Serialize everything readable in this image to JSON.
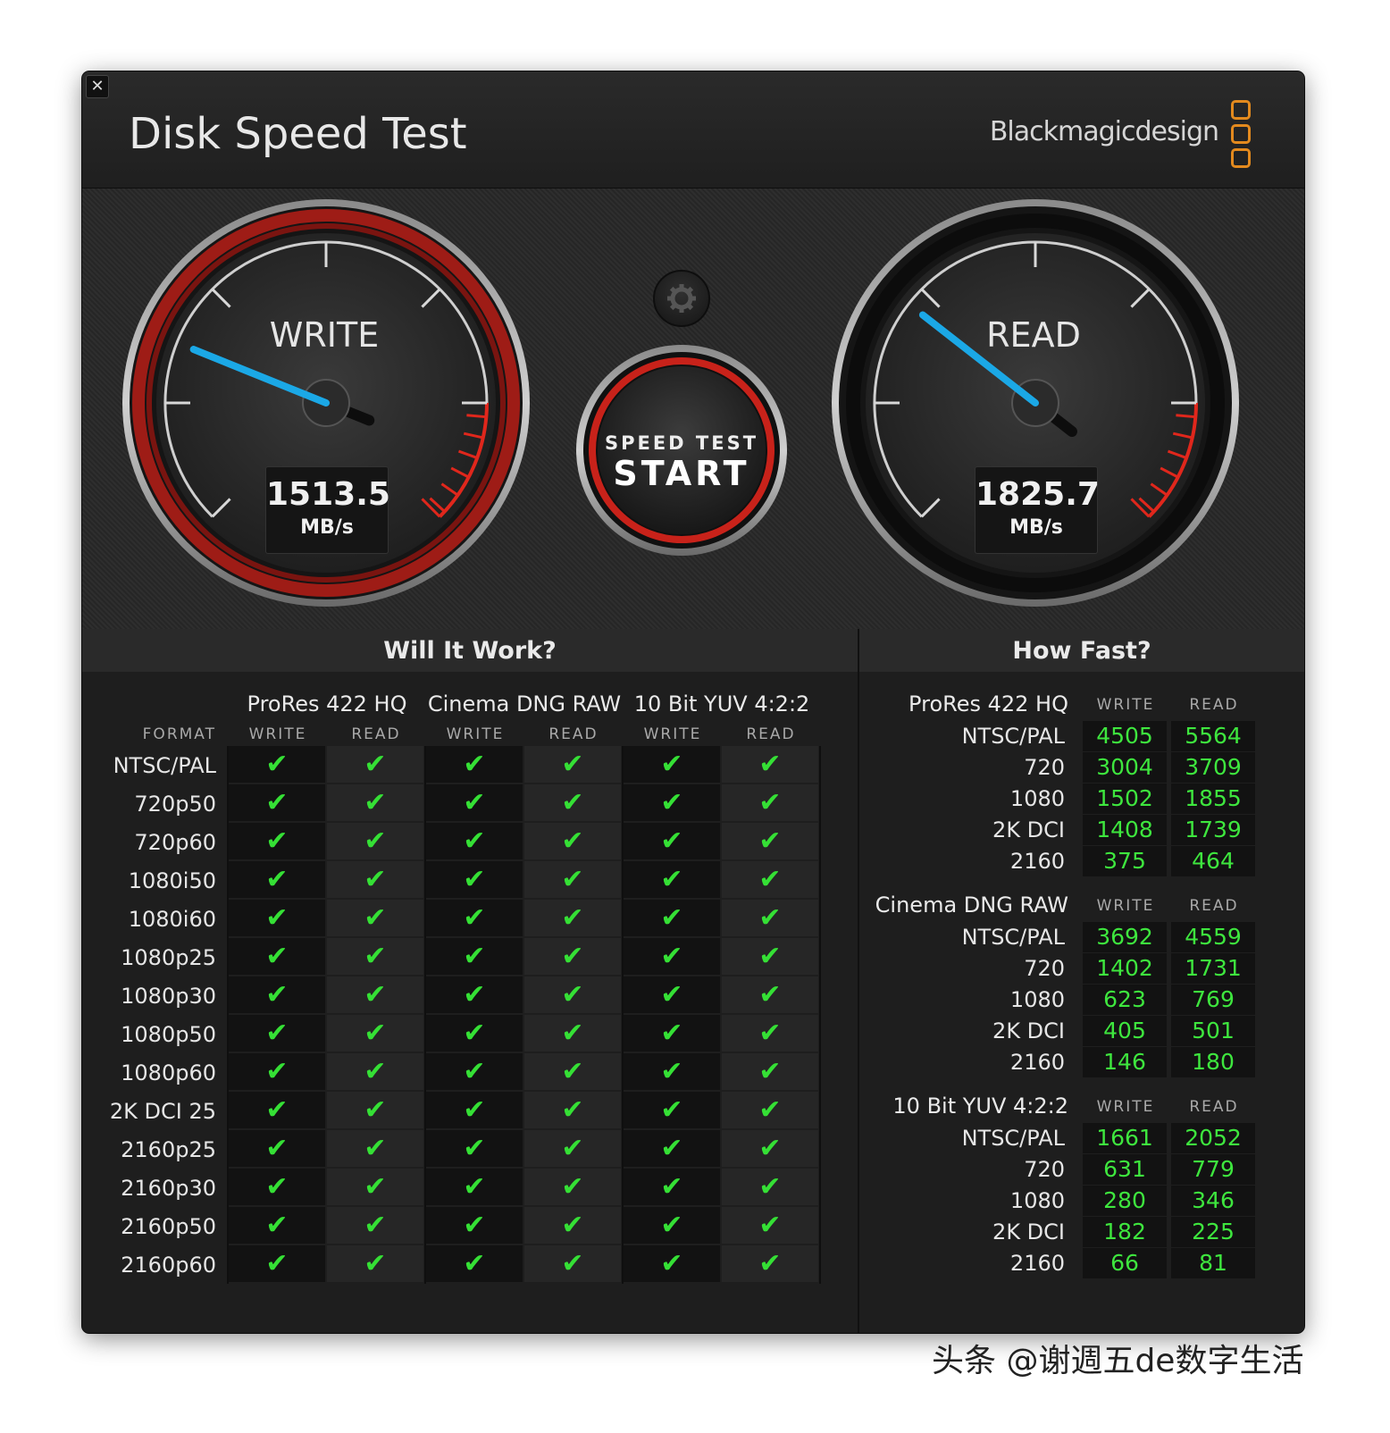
{
  "window": {
    "title": "Disk Speed Test",
    "brand": "Blackmagicdesign",
    "close_glyph": "✕"
  },
  "colors": {
    "accent_orange": "#e38a1e",
    "needle_blue": "#1ba8e6",
    "ok_green": "#35e035",
    "ring_red": "#c8221a"
  },
  "gauges": {
    "write": {
      "label": "WRITE",
      "value": "1513.5",
      "unit": "MB/s"
    },
    "read": {
      "label": "READ",
      "value": "1825.7",
      "unit": "MB/s"
    }
  },
  "start_button": {
    "line1": "SPEED TEST",
    "line2": "START"
  },
  "settings_icon": "gear-icon",
  "will_it_work": {
    "title": "Will It Work?",
    "format_header": "FORMAT",
    "codecs": [
      "ProRes 422 HQ",
      "Cinema DNG RAW",
      "10 Bit YUV 4:2:2"
    ],
    "sub_headers": [
      "WRITE",
      "READ",
      "WRITE",
      "READ",
      "WRITE",
      "READ"
    ],
    "check_glyph": "✔",
    "formats": [
      "NTSC/PAL",
      "720p50",
      "720p60",
      "1080i50",
      "1080i60",
      "1080p25",
      "1080p30",
      "1080p50",
      "1080p60",
      "2K DCI 25",
      "2160p25",
      "2160p30",
      "2160p50",
      "2160p60"
    ]
  },
  "how_fast": {
    "title": "How Fast?",
    "write_header": "WRITE",
    "read_header": "READ",
    "groups": [
      {
        "codec": "ProRes 422 HQ",
        "rows": [
          {
            "format": "NTSC/PAL",
            "write": "4505",
            "read": "5564"
          },
          {
            "format": "720",
            "write": "3004",
            "read": "3709"
          },
          {
            "format": "1080",
            "write": "1502",
            "read": "1855"
          },
          {
            "format": "2K DCI",
            "write": "1408",
            "read": "1739"
          },
          {
            "format": "2160",
            "write": "375",
            "read": "464"
          }
        ]
      },
      {
        "codec": "Cinema DNG RAW",
        "rows": [
          {
            "format": "NTSC/PAL",
            "write": "3692",
            "read": "4559"
          },
          {
            "format": "720",
            "write": "1402",
            "read": "1731"
          },
          {
            "format": "1080",
            "write": "623",
            "read": "769"
          },
          {
            "format": "2K DCI",
            "write": "405",
            "read": "501"
          },
          {
            "format": "2160",
            "write": "146",
            "read": "180"
          }
        ]
      },
      {
        "codec": "10 Bit YUV 4:2:2",
        "rows": [
          {
            "format": "NTSC/PAL",
            "write": "1661",
            "read": "2052"
          },
          {
            "format": "720",
            "write": "631",
            "read": "779"
          },
          {
            "format": "1080",
            "write": "280",
            "read": "346"
          },
          {
            "format": "2K DCI",
            "write": "182",
            "read": "225"
          },
          {
            "format": "2160",
            "write": "66",
            "read": "81"
          }
        ]
      }
    ]
  },
  "watermark": "头条 @谢週五de数字生活"
}
